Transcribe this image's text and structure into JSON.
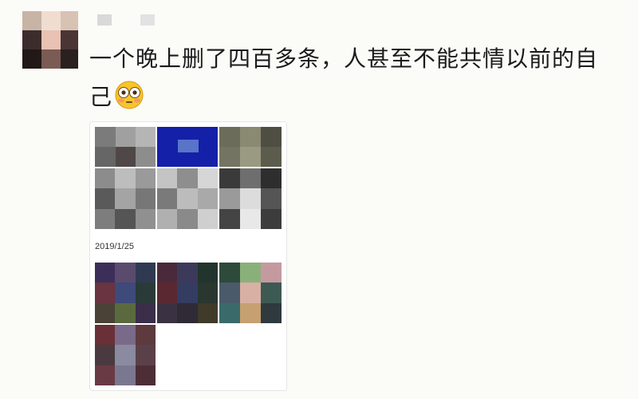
{
  "post": {
    "text_line1": "一个晚上删了四百多条，人甚至不能共情以前的自",
    "text_line2": "己",
    "emoji": "flushed-face-emoji"
  },
  "gallery": {
    "date_label": "2019/1/25"
  },
  "colors": {
    "background": "#fbfbf8",
    "text": "#1b1b1b",
    "blue_thumb": "#1420a8"
  }
}
